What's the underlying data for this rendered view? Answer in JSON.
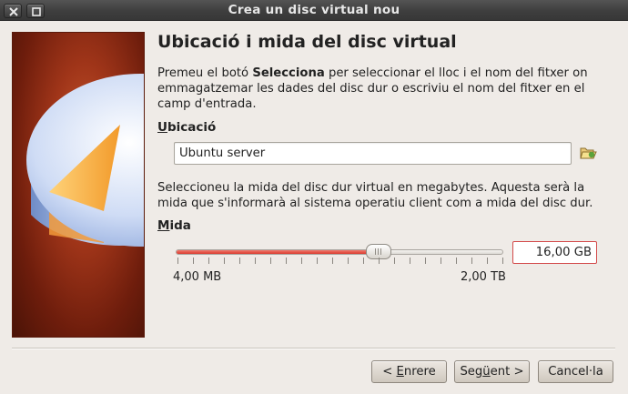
{
  "window": {
    "title": "Crea un disc virtual nou"
  },
  "page": {
    "heading": "Ubicació i mida del disc virtual",
    "intro": {
      "part1": "Premeu el botó ",
      "bold": "Selecciona",
      "part2": " per seleccionar el lloc i el nom del fitxer on emmagatzemar les dades del disc dur o escriviu el nom del fitxer en el camp d'entrada."
    }
  },
  "location": {
    "label_first": "U",
    "label_rest": "bicació",
    "value": "Ubuntu server",
    "browse_icon": "folder-open-icon"
  },
  "size": {
    "description": "Seleccioneu la mida del disc dur virtual en megabytes. Aquesta serà la mida que s'informarà al sistema operatiu client com a mida del disc dur.",
    "label_first": "M",
    "label_rest": "ida",
    "min_label": "4,00 MB",
    "max_label": "2,00 TB",
    "value": "16,00 GB",
    "slider_fraction": 0.62,
    "fill_color": "#dc3a2e",
    "input_border_color": "#d34a4a"
  },
  "buttons": {
    "back": {
      "prefix": "< ",
      "accel": "E",
      "rest": "nrere"
    },
    "next": {
      "prefix": "Seg",
      "accel": "ü",
      "rest": "ent >"
    },
    "cancel": {
      "label": "Cancel·la"
    }
  }
}
